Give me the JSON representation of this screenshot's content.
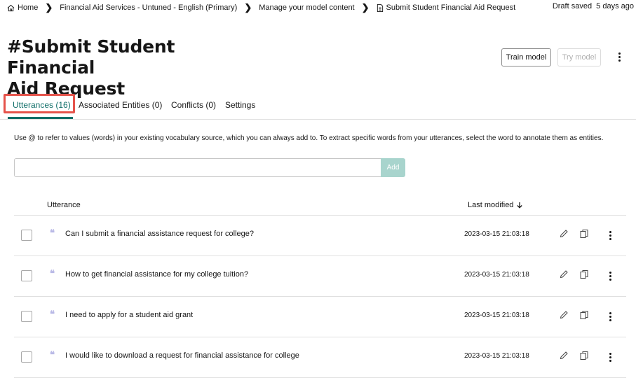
{
  "breadcrumb": {
    "items": [
      {
        "label": "Home",
        "icon": "home-icon"
      },
      {
        "label": "Financial Aid Services - Untuned - English (Primary)"
      },
      {
        "label": "Manage your model content"
      },
      {
        "label": "Submit Student Financial Aid Request",
        "icon": "document-icon"
      }
    ],
    "separator": "❯"
  },
  "status": {
    "draft": "Draft saved  5 days ago"
  },
  "page": {
    "title_line1": "#Submit Student Financial",
    "title_line2": "Aid Request"
  },
  "toolbar": {
    "train_label": "Train model",
    "try_label": "Try model",
    "more_icon": "overflow-menu-icon"
  },
  "tabs": [
    {
      "label": "Utterances (16)",
      "active": true
    },
    {
      "label": "Associated Entities (0)"
    },
    {
      "label": "Conflicts (0)"
    },
    {
      "label": "Settings"
    }
  ],
  "hint": "Use @ to refer to values (words) in your existing vocabulary source, which you can always add to. To extract specific words from your utterances, select the word to annotate them as entities.",
  "utterance_input": {
    "value": "",
    "placeholder": "",
    "add_label": "Add"
  },
  "table": {
    "columns": {
      "utterance": "Utterance",
      "last_modified": "Last modified",
      "sort_icon": "arrow-down-icon"
    },
    "rows": [
      {
        "text": "Can I submit a financial assistance request for college?",
        "modified": "2023-03-15 21:03:18"
      },
      {
        "text": "How to get financial assistance for my college tuition?",
        "modified": "2023-03-15 21:03:18"
      },
      {
        "text": "I need to apply for a student aid grant",
        "modified": "2023-03-15 21:03:18"
      },
      {
        "text": "I would like to download a request for financial assistance for college",
        "modified": "2023-03-15 21:03:18"
      }
    ],
    "quote_glyph": "❝"
  },
  "colors": {
    "accent": "#0f6e68",
    "highlight": "#e5534b",
    "add_button": "#a8d4cd"
  }
}
